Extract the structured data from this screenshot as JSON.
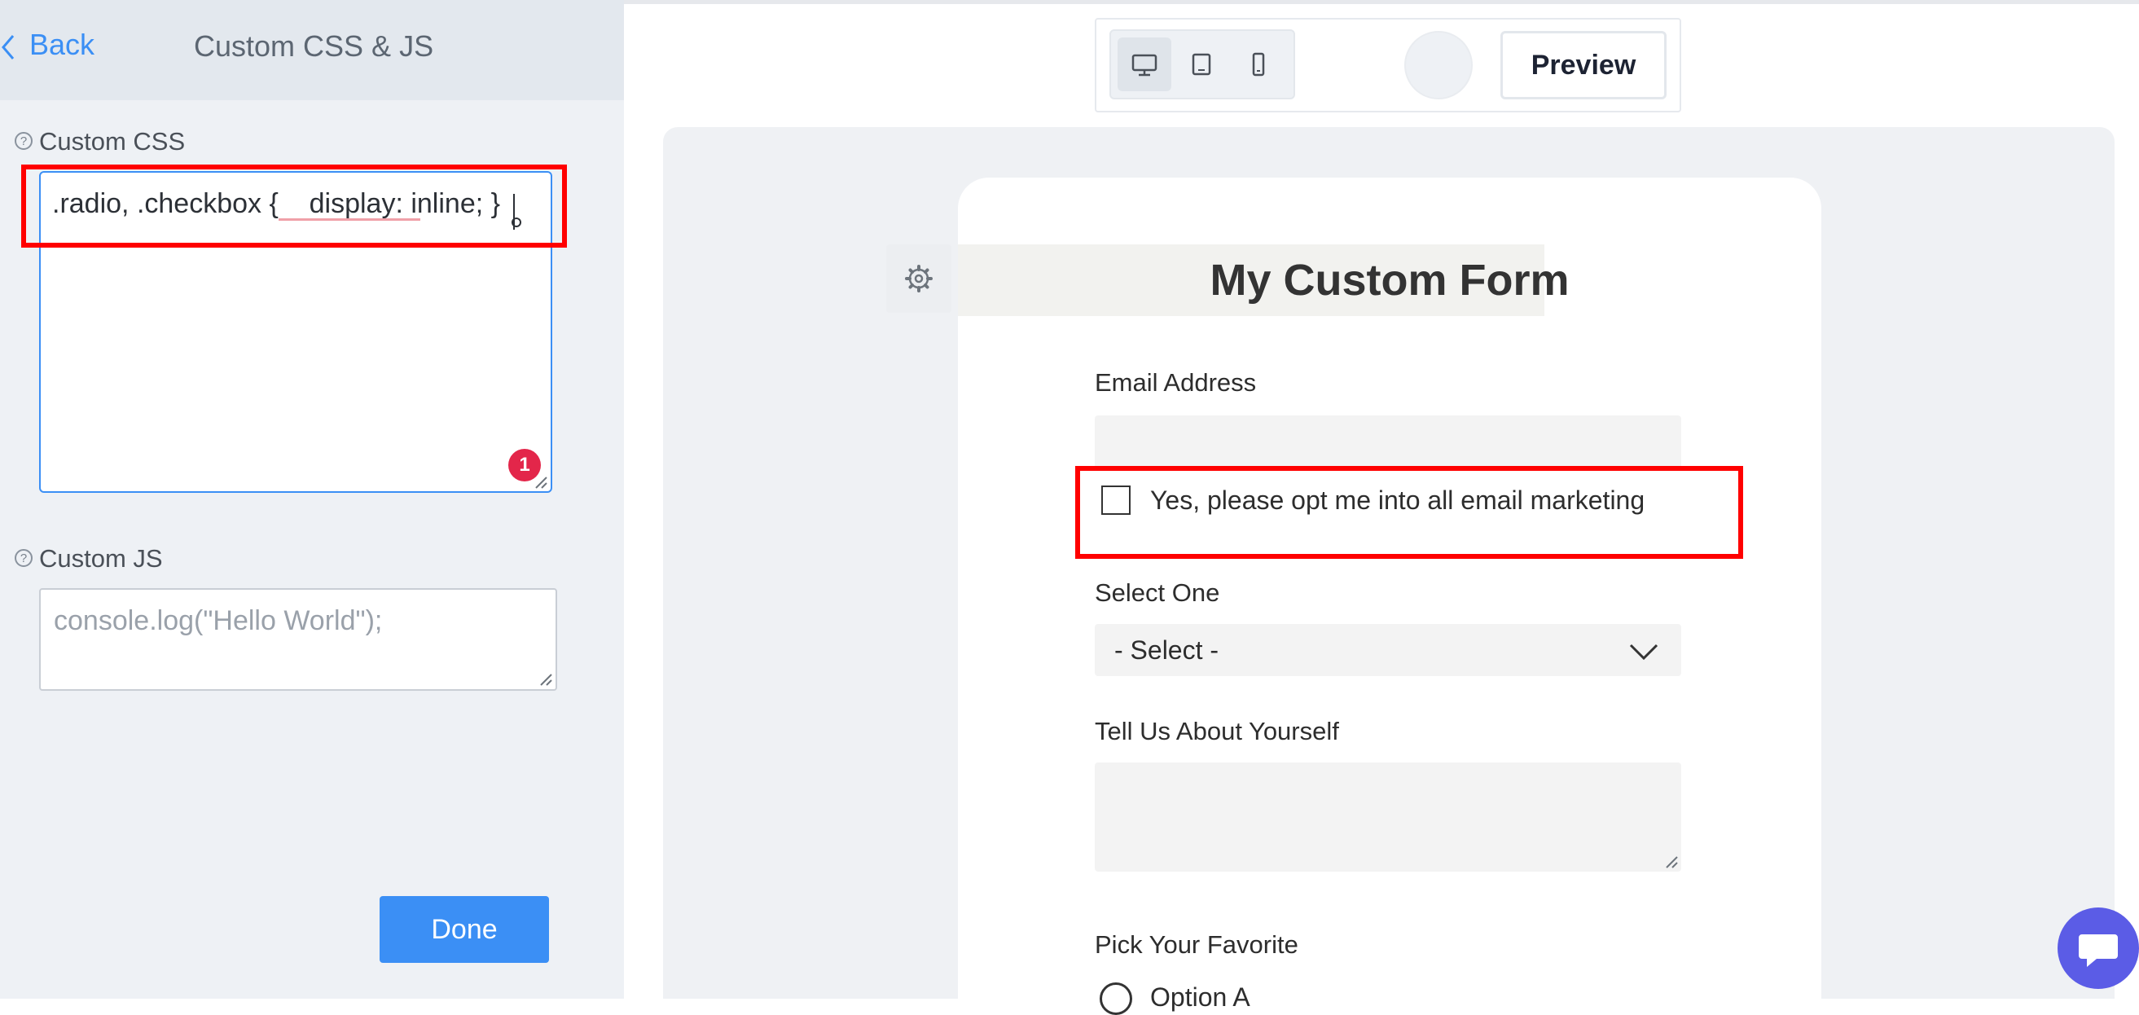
{
  "sidebar": {
    "back_label": "Back",
    "title": "Custom CSS & JS",
    "css_section_label": "Custom CSS",
    "css_value": ".radio, .checkbox {    display: inline; }",
    "error_count": "1",
    "js_section_label": "Custom JS",
    "js_placeholder": "console.log(\"Hello World\");",
    "done_label": "Done",
    "help_icon_glyph": "?"
  },
  "toolbar": {
    "devices": [
      "desktop-icon",
      "tablet-icon",
      "mobile-icon"
    ],
    "active_device": "desktop",
    "preview_label": "Preview"
  },
  "form": {
    "title": "My Custom Form",
    "email_label": "Email Address",
    "checkbox_label": "Yes, please opt me into all email marketing",
    "select_label": "Select One",
    "select_value": "- Select -",
    "textarea_label": "Tell Us About Yourself",
    "radio_group_label": "Pick Your Favorite",
    "radio_option_a": "Option A"
  },
  "colors": {
    "accent": "#3b8ff5",
    "highlight": "#ff0000",
    "error": "#e3264a",
    "chat": "#5b5ce6"
  }
}
